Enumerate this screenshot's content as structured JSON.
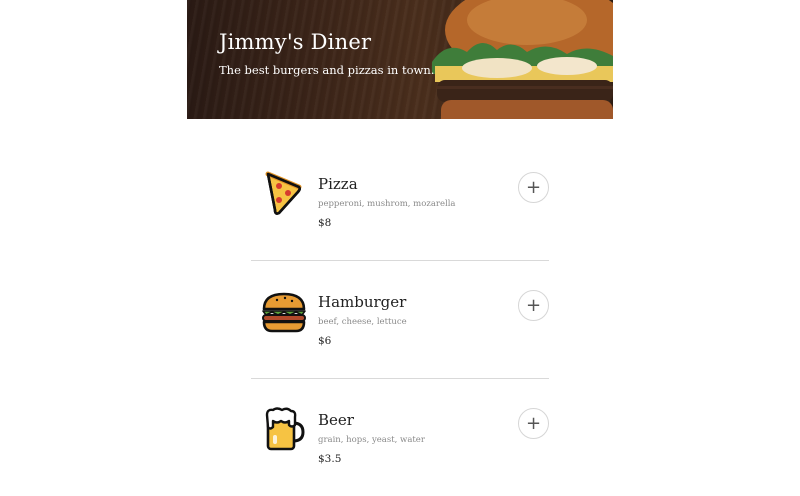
{
  "header": {
    "title": "Jimmy's Diner",
    "subtitle": "The best burgers and pizzas in town."
  },
  "menu": {
    "items": [
      {
        "name": "Pizza",
        "ingredients": "pepperoni, mushrom, mozarella",
        "price": "$8",
        "icon": "pizza-slice-icon",
        "add_label": "+"
      },
      {
        "name": "Hamburger",
        "ingredients": "beef, cheese, lettuce",
        "price": "$6",
        "icon": "hamburger-icon",
        "add_label": "+"
      },
      {
        "name": "Beer",
        "ingredients": "grain, hops, yeast, water",
        "price": "$3.5",
        "icon": "beer-mug-icon",
        "add_label": "+"
      }
    ]
  },
  "colors": {
    "hero_background": "#3b2418",
    "divider": "#d9d9d9",
    "ingredients_text": "#8a8a8a"
  }
}
